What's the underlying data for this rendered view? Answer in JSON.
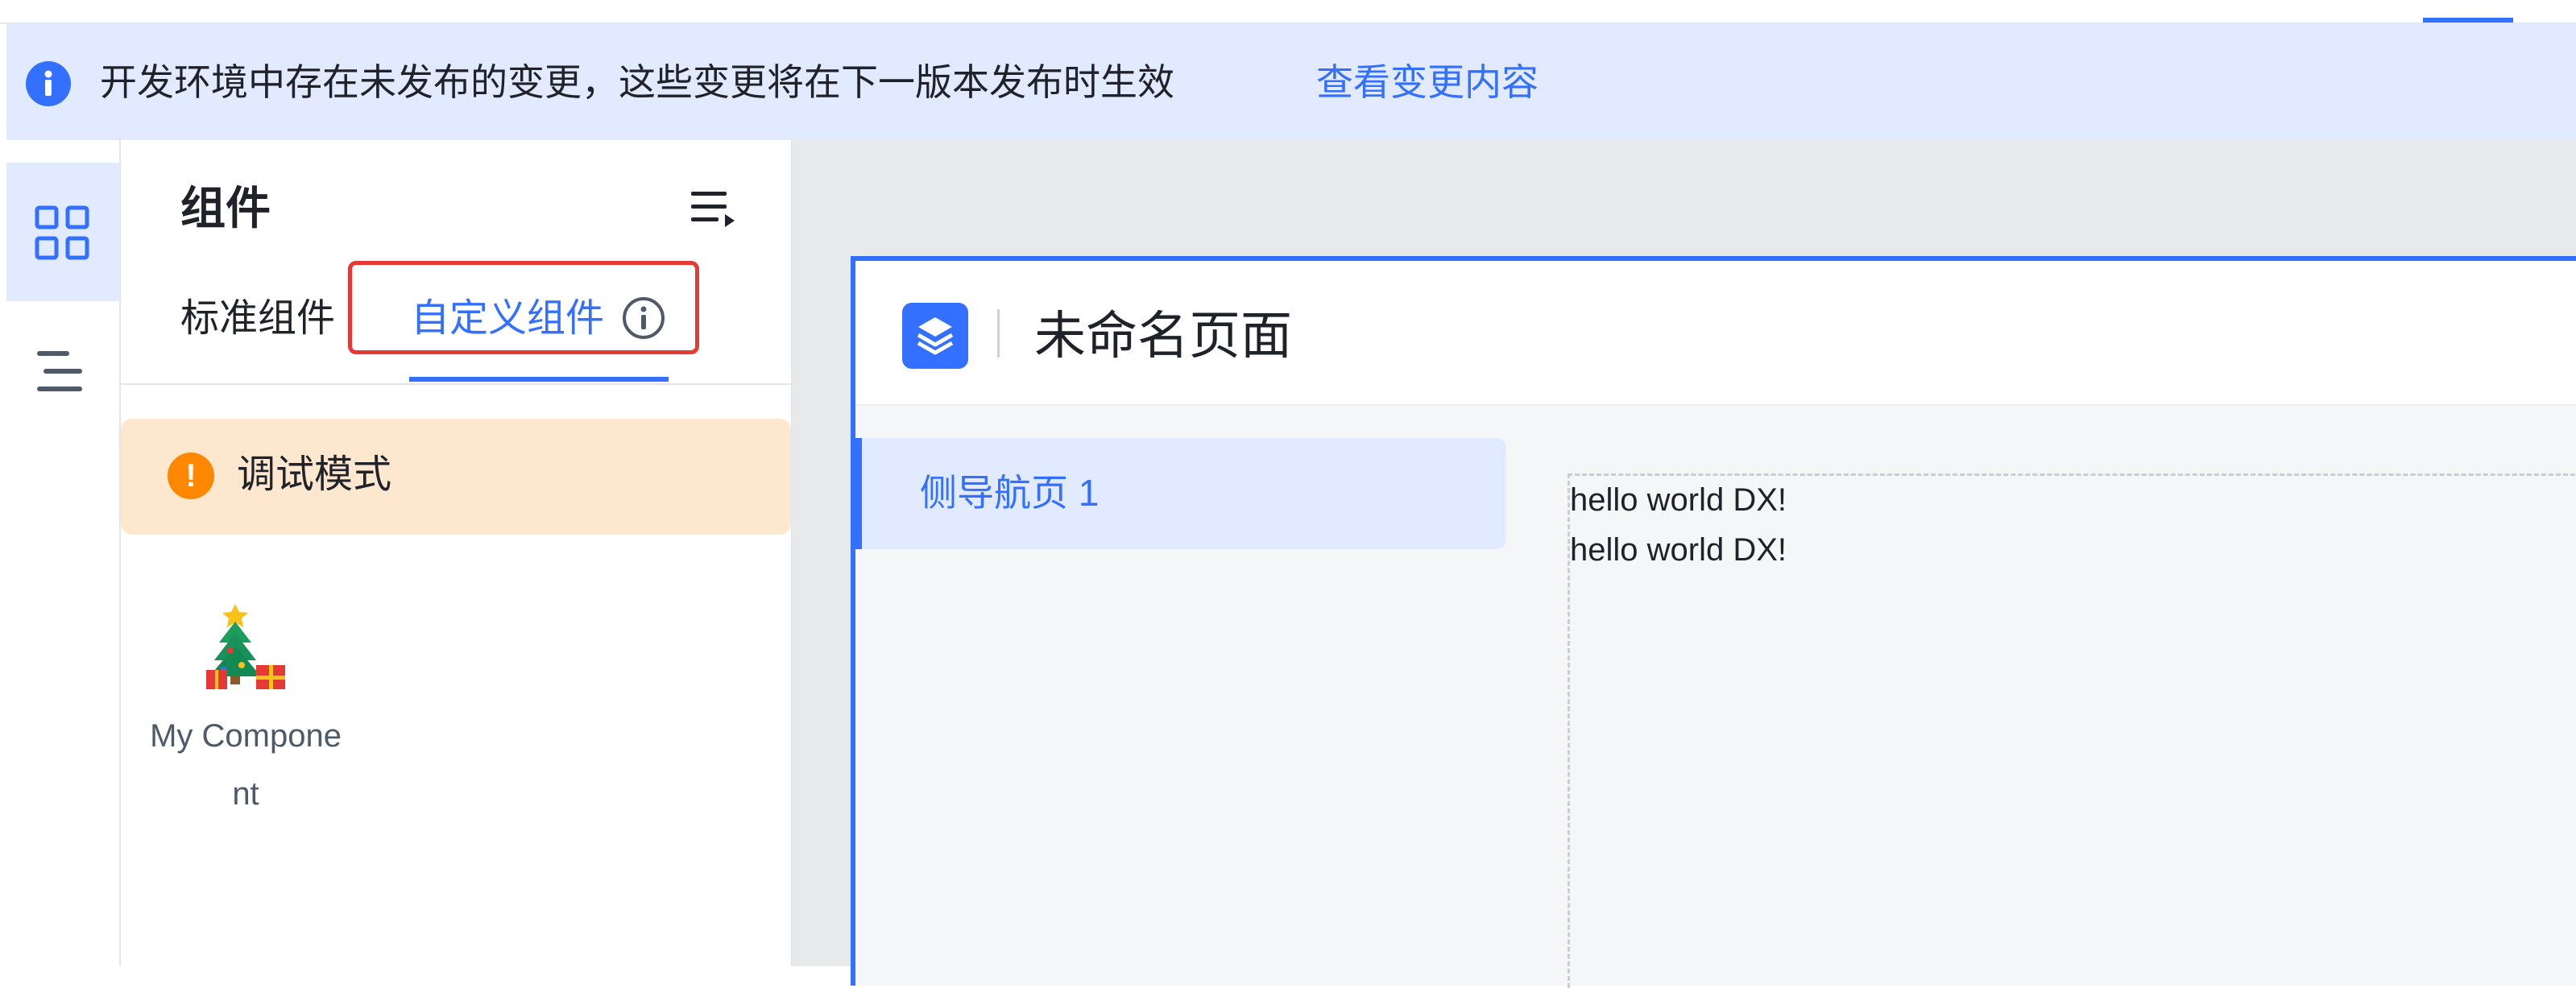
{
  "notice": {
    "message": "开发环境中存在未发布的变更，这些变更将在下一版本发布时生效",
    "link": "查看变更内容"
  },
  "left_rail": {
    "items": [
      {
        "icon": "grid-icon",
        "active": true
      },
      {
        "icon": "outline-icon",
        "active": false
      }
    ]
  },
  "panel": {
    "title": "组件",
    "tabs": [
      {
        "label": "标准组件",
        "active": false
      },
      {
        "label": "自定义组件",
        "active": true
      }
    ],
    "debug_banner": {
      "label": "调试模式",
      "icon_text": "!"
    },
    "components": [
      {
        "name": "My Component",
        "icon": "christmas-tree-icon"
      }
    ]
  },
  "canvas": {
    "page_title": "未命名页面",
    "nav_item": "侧导航页 1",
    "content_lines": [
      "hello world DX!",
      "hello world DX!"
    ]
  },
  "colors": {
    "accent": "#3370ff",
    "notice_bg": "#e1eaff",
    "debug_bg": "#fde8cf",
    "warning": "#ff8800",
    "highlight_border": "#e53935"
  }
}
